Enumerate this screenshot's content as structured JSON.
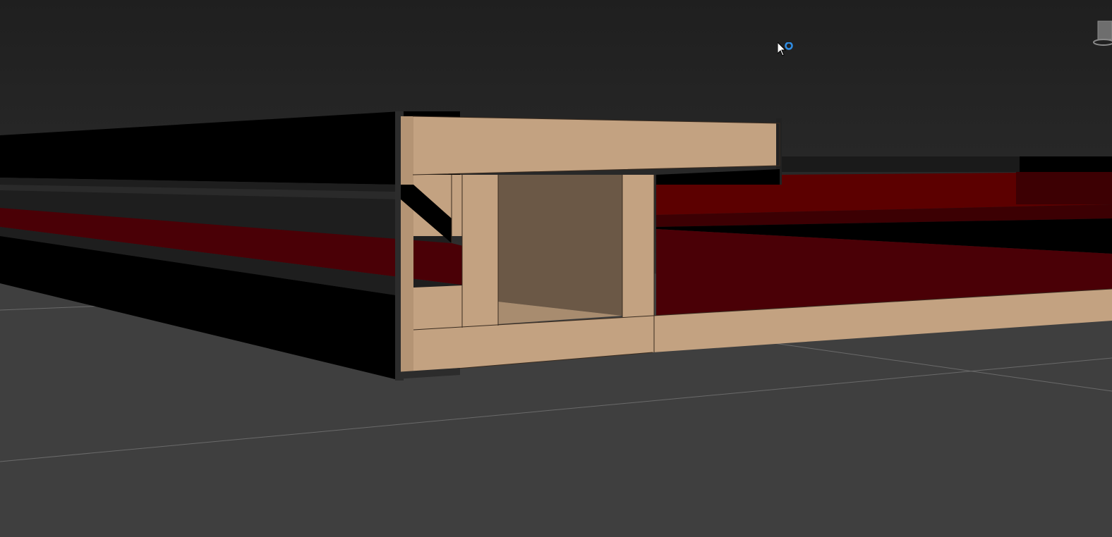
{
  "viewport": {
    "background_top": "#1f1f1f",
    "background_bottom": "#4b4b4b",
    "grid_color": "#6a6a6a"
  },
  "model": {
    "wood_color": "#c3a281",
    "wood_shadow": "#6b5846",
    "dark_red": "#4a0006",
    "red": "#5c0000",
    "black": "#000000",
    "dark_gray": "#1d1d1d"
  },
  "cursor": {
    "icon": "arrow-cursor-icon",
    "badge_icon": "busy-ring-icon",
    "badge_color": "#2f8de4"
  },
  "viewcube": {
    "icon": "viewcube-icon"
  }
}
